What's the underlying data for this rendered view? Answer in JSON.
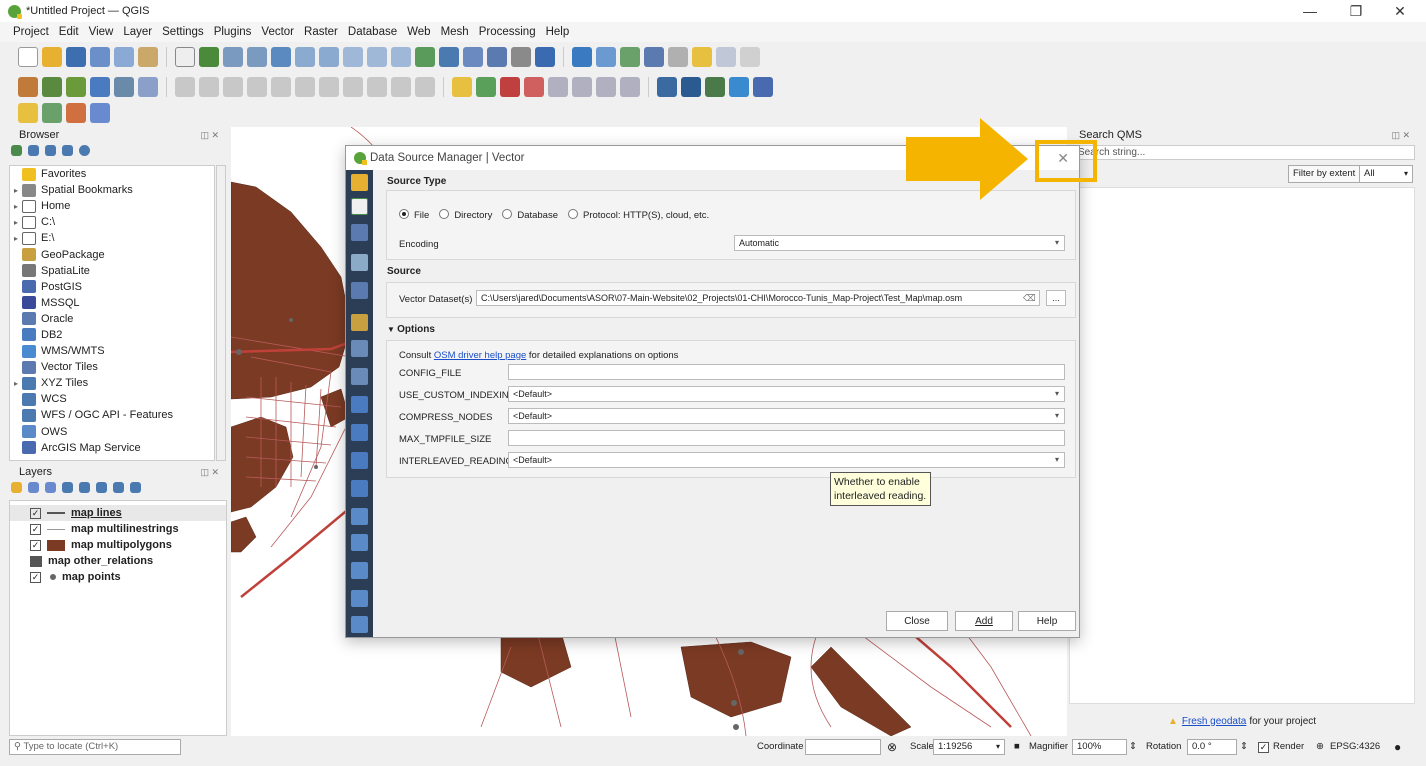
{
  "window": {
    "title": "*Untitled Project — QGIS",
    "minimize": "—",
    "maximize": "❐",
    "close": "✕"
  },
  "menu": [
    "Project",
    "Edit",
    "View",
    "Layer",
    "Settings",
    "Plugins",
    "Vector",
    "Raster",
    "Database",
    "Web",
    "Mesh",
    "Processing",
    "Help"
  ],
  "browser": {
    "title": "Browser",
    "items": [
      {
        "label": "Favorites",
        "icon": "star-icon",
        "arrow": ""
      },
      {
        "label": "Spatial Bookmarks",
        "icon": "bookmark-icon",
        "arrow": "▸"
      },
      {
        "label": "Home",
        "icon": "home-icon",
        "arrow": "▸"
      },
      {
        "label": "C:\\",
        "icon": "folder-icon",
        "arrow": "▸"
      },
      {
        "label": "E:\\",
        "icon": "folder-icon",
        "arrow": "▸"
      },
      {
        "label": "GeoPackage",
        "icon": "geopackage-icon",
        "arrow": ""
      },
      {
        "label": "SpatiaLite",
        "icon": "spatialite-icon",
        "arrow": ""
      },
      {
        "label": "PostGIS",
        "icon": "postgis-icon",
        "arrow": ""
      },
      {
        "label": "MSSQL",
        "icon": "mssql-icon",
        "arrow": ""
      },
      {
        "label": "Oracle",
        "icon": "oracle-icon",
        "arrow": ""
      },
      {
        "label": "DB2",
        "icon": "db2-icon",
        "arrow": ""
      },
      {
        "label": "WMS/WMTS",
        "icon": "wms-icon",
        "arrow": ""
      },
      {
        "label": "Vector Tiles",
        "icon": "vector-tiles-icon",
        "arrow": ""
      },
      {
        "label": "XYZ Tiles",
        "icon": "xyz-tiles-icon",
        "arrow": "▸"
      },
      {
        "label": "WCS",
        "icon": "wcs-icon",
        "arrow": ""
      },
      {
        "label": "WFS / OGC API - Features",
        "icon": "wfs-icon",
        "arrow": ""
      },
      {
        "label": "OWS",
        "icon": "ows-icon",
        "arrow": ""
      },
      {
        "label": "ArcGIS Map Service",
        "icon": "arcgis-icon",
        "arrow": ""
      }
    ]
  },
  "layers": {
    "title": "Layers",
    "items": [
      {
        "label": "map lines",
        "checked": "✓",
        "swatch": "line"
      },
      {
        "label": "map multilinestrings",
        "checked": "✓",
        "swatch": "thinline"
      },
      {
        "label": "map multipolygons",
        "checked": "✓",
        "swatch": "polygon"
      },
      {
        "label": "map other_relations",
        "checked": "",
        "swatch": "table"
      },
      {
        "label": "map points",
        "checked": "✓",
        "swatch": "point"
      }
    ]
  },
  "qms": {
    "title": "Search QMS",
    "search_placeholder": "Search string...",
    "filter_button": "Filter by extent",
    "filter_value": "All",
    "footer_link": "Fresh geodata",
    "footer_text": "for your project"
  },
  "status": {
    "locate_placeholder": "Type to locate (Ctrl+K)",
    "coordinate_label": "Coordinate",
    "coordinate_value": "",
    "scale_label": "Scale",
    "scale_value": "1:19256",
    "magnifier_label": "Magnifier",
    "magnifier_value": "100%",
    "rotation_label": "Rotation",
    "rotation_value": "0.0 °",
    "render_label": "Render",
    "crs": "EPSG:4326"
  },
  "dialog": {
    "title": "Data Source Manager | Vector",
    "close_icon": "✕",
    "source_type_header": "Source Type",
    "radios": [
      {
        "label": "File",
        "selected": true
      },
      {
        "label": "Directory",
        "selected": false
      },
      {
        "label": "Database",
        "selected": false
      },
      {
        "label": "Protocol: HTTP(S), cloud, etc.",
        "selected": false
      }
    ],
    "encoding_label": "Encoding",
    "encoding_value": "Automatic",
    "source_header": "Source",
    "dataset_label": "Vector Dataset(s)",
    "dataset_value": "C:\\Users\\jared\\Documents\\ASOR\\07-Main-Website\\02_Projects\\01-CHI\\Morocco-Tunis_Map-Project\\Test_Map\\map.osm",
    "browse_button": "...",
    "options_header": "Options",
    "consult_prefix": "Consult",
    "consult_link": "OSM driver help page",
    "consult_suffix": "for detailed explanations on options",
    "options": [
      {
        "label": "CONFIG_FILE",
        "value": "",
        "type": "text"
      },
      {
        "label": "USE_CUSTOM_INDEXING",
        "value": "<Default>",
        "type": "combo"
      },
      {
        "label": "COMPRESS_NODES",
        "value": "<Default>",
        "type": "combo"
      },
      {
        "label": "MAX_TMPFILE_SIZE",
        "value": "",
        "type": "text"
      },
      {
        "label": "INTERLEAVED_READING",
        "value": "<Default>",
        "type": "combo"
      }
    ],
    "tooltip": "Whether to enable interleaved reading.",
    "buttons": {
      "close": "Close",
      "add": "Add",
      "help": "Help"
    }
  },
  "colors": {
    "accent_annotation": "#f5b400",
    "polygon": "#7b3a23",
    "line": "#c0413a",
    "sidebar": "#2c3e55"
  }
}
